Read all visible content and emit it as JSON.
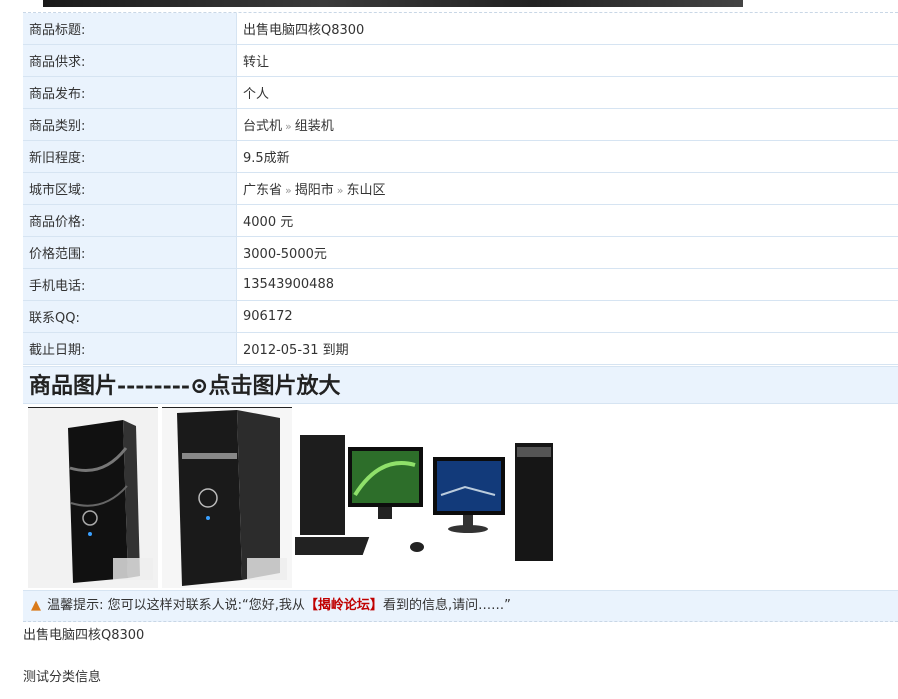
{
  "details": [
    {
      "label": "商品标题:",
      "value": "出售电脑四核Q8300"
    },
    {
      "label": "商品供求:",
      "value": "转让"
    },
    {
      "label": "商品发布:",
      "value": "个人"
    },
    {
      "label": "商品类别:",
      "value_parts": [
        "台式机",
        "组装机"
      ]
    },
    {
      "label": "新旧程度:",
      "value": "9.5成新"
    },
    {
      "label": "城市区域:",
      "value_parts": [
        "广东省",
        "揭阳市",
        "东山区"
      ]
    },
    {
      "label": "商品价格:",
      "value": "4000 元"
    },
    {
      "label": "价格范围:",
      "value": "3000-5000元"
    },
    {
      "label": "手机电话:",
      "value": "13543900488"
    },
    {
      "label": "联系QQ:",
      "value": "906172"
    },
    {
      "label": "截止日期:",
      "value": "2012-05-31 到期"
    }
  ],
  "breadcrumb_separator": "»",
  "gallery": {
    "title": "商品图片--------⊙点击图片放大",
    "images": [
      {
        "icon": "dell-tower-pc-image"
      },
      {
        "icon": "dell-tower-pc-image"
      },
      {
        "icon": "desktop-set-image"
      }
    ]
  },
  "tip": {
    "icon": "bell-icon",
    "prefix": "温馨提示:",
    "text_before": "您可以这样对联系人说:“您好,我从",
    "forum": "【揭岭论坛】",
    "text_after": "看到的信息,请问……”"
  },
  "description": {
    "line1": "出售电脑四核Q8300",
    "line2": "测试分类信息"
  }
}
